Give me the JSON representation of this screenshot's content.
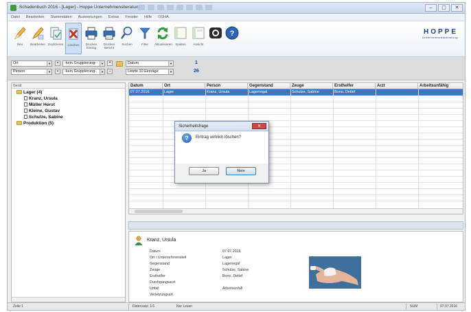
{
  "window": {
    "title": "Schadenbuch 2016 - [Lager] - Hoppe Unternehmensberatung",
    "controls": [
      "–",
      "▢",
      "✕"
    ]
  },
  "menu": {
    "items": [
      "Datei",
      "Bearbeiten",
      "Stammdaten",
      "Auswertungen",
      "Extras",
      "Fenster",
      "Hilfe",
      "OSHA"
    ]
  },
  "toolbar": {
    "buttons": [
      {
        "label": "Neu",
        "icon": "pencil-new-icon"
      },
      {
        "label": "Bearbeiten",
        "icon": "pencil-edit-icon"
      },
      {
        "label": "Duplizieren",
        "icon": "duplicate-icon"
      },
      {
        "label": "Löschen",
        "icon": "delete-icon"
      },
      {
        "label": "Drucken Eintrag",
        "icon": "printer-icon"
      },
      {
        "label": "Drucken Bericht",
        "icon": "printer-report-icon"
      },
      {
        "label": "Suchen",
        "icon": "search-icon"
      },
      {
        "label": "Filter",
        "icon": "filter-icon"
      },
      {
        "label": "Aktualisieren",
        "icon": "refresh-icon"
      },
      {
        "label": "Spalten",
        "icon": "columns-icon"
      },
      {
        "label": "Ansicht",
        "icon": "view-icon"
      },
      {
        "label": "Kamera",
        "icon": "camera-icon"
      },
      {
        "label": "Hilfe",
        "icon": "help-icon"
      }
    ]
  },
  "logo": {
    "main": "HOPPE",
    "sub": "Unternehmensberatung"
  },
  "filters": {
    "left1": "Ort",
    "left2": "Person",
    "cond1": "-kein Gruppierung-",
    "cond2": "-kein Gruppierung-",
    "date_field": "Datum",
    "period": "Letzte 10 Einträge",
    "count_top": "1",
    "count_bottom": "26"
  },
  "tree": {
    "header": "Gerät",
    "nodes": [
      {
        "label": "Lager (4)",
        "type": "folder"
      },
      {
        "label": "Kranz, Ursula",
        "type": "item"
      },
      {
        "label": "Müller Horst",
        "type": "item"
      },
      {
        "label": "Kleine, Gustav",
        "type": "item"
      },
      {
        "label": "Schulze, Sabine",
        "type": "item"
      },
      {
        "label": "Produktion (5)",
        "type": "folder"
      }
    ]
  },
  "grid": {
    "columns": [
      "Datum",
      "Ort",
      "Person",
      "Gegenstand",
      "Zeuge",
      "Ersthelfer",
      "Arzt",
      "Arbeitsunfähig"
    ],
    "selected_row": [
      "07.07.2016",
      "Lager",
      "Kranz, Ursula",
      "Lagerregal",
      "Schulze, Sabine",
      "Bono, Detlef",
      "",
      ""
    ]
  },
  "detail": {
    "name": "Kranz, Ursula",
    "rows": [
      {
        "label": "Datum",
        "value": "07.07.2016"
      },
      {
        "label": "Ort / Unternehmensteil",
        "value": "Lager"
      },
      {
        "label": "Gegenstand",
        "value": "Lagerregal"
      },
      {
        "label": "Zeuge",
        "value": "Schulze, Sabine"
      },
      {
        "label": "Ersthelfer",
        "value": "Bono, Detlef"
      },
      {
        "label": "Durchgangsarzt",
        "value": ""
      },
      {
        "label": "Unfall",
        "value": "Arbeitsunfall"
      },
      {
        "label": "Verletzungsart",
        "value": ""
      }
    ]
  },
  "status": {
    "left": "Zeile 1",
    "count": "Datensatz: 1/1",
    "mode": "Nur Lesen",
    "num": "NUM",
    "date": "07.07.2016"
  },
  "dialog": {
    "title": "Sicherheitsfrage",
    "message": "Eintrag wirklich löschen?",
    "yes": "Ja",
    "no": "Nein",
    "close": "✕"
  },
  "colors": {
    "selection": "#3779c8",
    "brand": "#1b3fa6",
    "delete_red": "#c8302c"
  }
}
